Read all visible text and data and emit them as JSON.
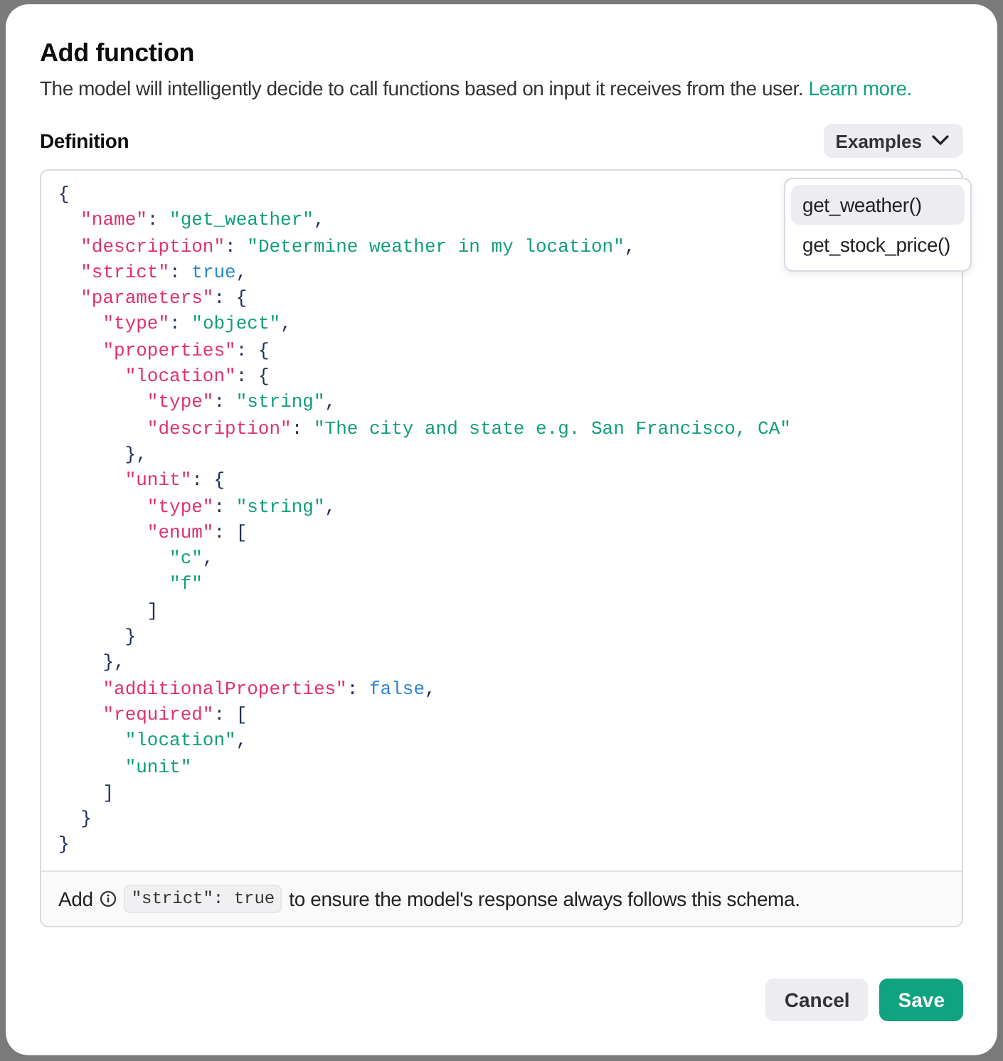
{
  "dialog": {
    "title": "Add function",
    "description": "The model will intelligently decide to call functions based on input it receives from the user.",
    "link": "Learn more."
  },
  "definition": {
    "label": "Definition",
    "examples_button": "Examples",
    "menu": [
      {
        "label": "get_weather()",
        "selected": true
      },
      {
        "label": "get_stock_price()",
        "selected": false
      }
    ],
    "code_lines": [
      "{",
      "  \"name\": \"get_weather\",",
      "  \"description\": \"Determine weather in my location\",",
      "  \"strict\": true,",
      "  \"parameters\": {",
      "    \"type\": \"object\",",
      "    \"properties\": {",
      "      \"location\": {",
      "        \"type\": \"string\",",
      "        \"description\": \"The city and state e.g. San Francisco, CA\"",
      "      },",
      "      \"unit\": {",
      "        \"type\": \"string\",",
      "        \"enum\": [",
      "          \"c\",",
      "          \"f\"",
      "        ]",
      "      }",
      "    },",
      "    \"additionalProperties\": false,",
      "    \"required\": [",
      "      \"location\",",
      "      \"unit\"",
      "    ]",
      "  }",
      "}"
    ],
    "hint": {
      "before": "Add",
      "code": "\"strict\": true",
      "after": "to ensure the model's response always follows this schema."
    }
  },
  "buttons": [
    {
      "label": "Cancel",
      "kind": "secondary"
    },
    {
      "label": "Save",
      "kind": "primary"
    }
  ]
}
